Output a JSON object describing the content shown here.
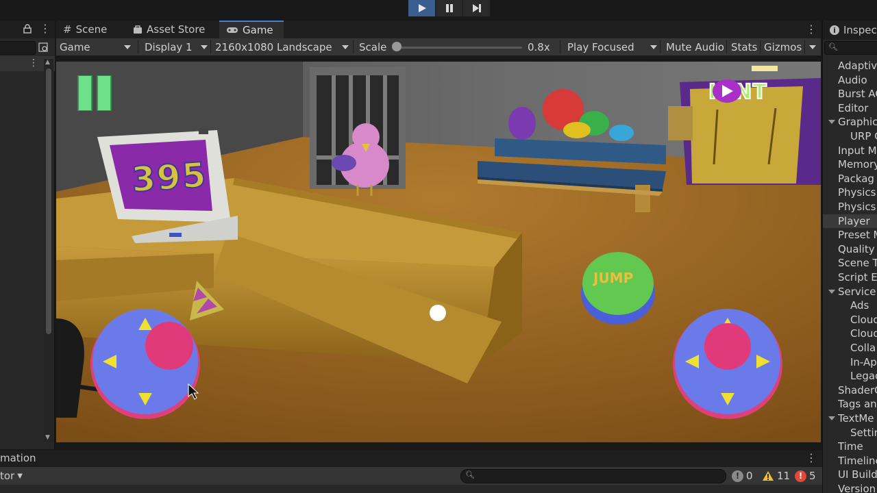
{
  "toolbar": {
    "play_icon": "play-icon",
    "pause_icon": "pause-icon",
    "step_icon": "step-icon"
  },
  "tabs": [
    {
      "label": "Scene",
      "icon": "grid-icon"
    },
    {
      "label": "Asset Store",
      "icon": "shopping-bag-icon"
    },
    {
      "label": "Game",
      "icon": "gamepad-icon"
    }
  ],
  "game_bar": {
    "display_mode": "Game",
    "display": "Display 1",
    "resolution": "2160x1080 Landscape",
    "scale_label": "Scale",
    "scale_value": "0.8x",
    "scale_fraction": 0.0,
    "play_mode": "Play Focused",
    "mute": "Mute Audio",
    "stats": "Stats",
    "gizmos": "Gizmos"
  },
  "game": {
    "score": "395",
    "hint_label": "HINT",
    "jump_label": "JUMP"
  },
  "inspector": {
    "tab_label": "Inspec",
    "items": [
      {
        "label": "Adaptiv",
        "indent": 0
      },
      {
        "label": "Audio",
        "indent": 0
      },
      {
        "label": "Burst AC",
        "indent": 0
      },
      {
        "label": "Editor",
        "indent": 0
      },
      {
        "label": "Graphic",
        "indent": 0,
        "expanded": true
      },
      {
        "label": "URP G",
        "indent": 1
      },
      {
        "label": "Input Ma",
        "indent": 0
      },
      {
        "label": "Memory",
        "indent": 0
      },
      {
        "label": "Packag",
        "indent": 0
      },
      {
        "label": "Physics",
        "indent": 0
      },
      {
        "label": "Physics",
        "indent": 0
      },
      {
        "label": "Player",
        "indent": 0,
        "selected": true
      },
      {
        "label": "Preset M",
        "indent": 0
      },
      {
        "label": "Quality",
        "indent": 0
      },
      {
        "label": "Scene T",
        "indent": 0
      },
      {
        "label": "Script E",
        "indent": 0
      },
      {
        "label": "Service",
        "indent": 0,
        "expanded": true
      },
      {
        "label": "Ads",
        "indent": 1
      },
      {
        "label": "Cloud",
        "indent": 1
      },
      {
        "label": "Cloud",
        "indent": 1
      },
      {
        "label": "Colla",
        "indent": 1
      },
      {
        "label": "In-Ap",
        "indent": 1
      },
      {
        "label": "Legac",
        "indent": 1
      },
      {
        "label": "ShaderG",
        "indent": 0
      },
      {
        "label": "Tags an",
        "indent": 0
      },
      {
        "label": "TextMe",
        "indent": 0,
        "expanded": true
      },
      {
        "label": "Settir",
        "indent": 1
      },
      {
        "label": "Time",
        "indent": 0
      },
      {
        "label": "Timeline",
        "indent": 0
      },
      {
        "label": "UI Build",
        "indent": 0
      },
      {
        "label": "Version",
        "indent": 0
      }
    ]
  },
  "bottom": {
    "tab_label": "mation",
    "dropdown_label": "tor",
    "log_count": "0",
    "warning_count": "11",
    "error_count": "5"
  },
  "colors": {
    "accent": "#3d82d6",
    "panel": "#282828",
    "toolbar": "#353535",
    "warning": "#f0c030",
    "error": "#e04a3a"
  }
}
